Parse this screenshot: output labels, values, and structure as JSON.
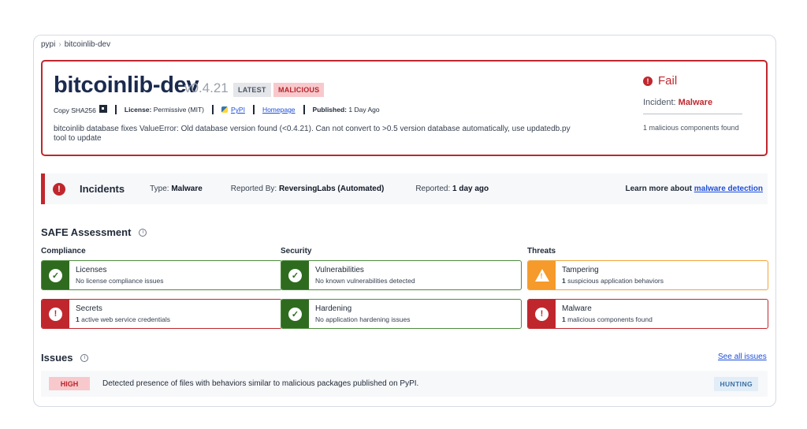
{
  "breadcrumb": {
    "root": "pypi",
    "separator": "›",
    "current": "bitcoinlib-dev"
  },
  "package": {
    "name": "bitcoinlib-dev",
    "version": "v0.4.21",
    "tags": {
      "latest": "LATEST",
      "malicious": "MALICIOUS"
    },
    "meta": {
      "copy_sha": "Copy SHA256",
      "license_label": "License:",
      "license_value": "Permissive (MIT)",
      "pypi_link": "PyPI",
      "homepage_link": "Homepage",
      "published_label": "Published:",
      "published_value": "1 Day Ago"
    },
    "description": "bitcoinlib database fixes ValueError: Old database version found (<0.4.21). Can not convert to >0.5 version database automatically, use updatedb.py tool to update"
  },
  "status": {
    "fail_label": "Fail",
    "incident_label": "Incident:",
    "incident_value": "Malware",
    "summary": "1 malicious components found"
  },
  "incidents": {
    "title": "Incidents",
    "type_label": "Type:",
    "type_value": "Malware",
    "reported_by_label": "Reported By:",
    "reported_by_value": "ReversingLabs (Automated)",
    "reported_label": "Reported:",
    "reported_value": "1 day ago",
    "learn_text": "Learn more about",
    "learn_link": "malware detection"
  },
  "safe": {
    "title": "SAFE Assessment",
    "columns": [
      {
        "heading": "Compliance",
        "cards": [
          {
            "title": "Licenses",
            "count": "",
            "subtitle": "No license compliance issues",
            "status": "ok"
          },
          {
            "title": "Secrets",
            "count": "1",
            "subtitle": " active web service credentials",
            "status": "bad"
          }
        ]
      },
      {
        "heading": "Security",
        "cards": [
          {
            "title": "Vulnerabilities",
            "count": "",
            "subtitle": "No known vulnerabilities detected",
            "status": "ok"
          },
          {
            "title": "Hardening",
            "count": "",
            "subtitle": "No application hardening issues",
            "status": "ok"
          }
        ]
      },
      {
        "heading": "Threats",
        "cards": [
          {
            "title": "Tampering",
            "count": "1",
            "subtitle": " suspicious application behaviors",
            "status": "warn"
          },
          {
            "title": "Malware",
            "count": "1",
            "subtitle": " malicious components found",
            "status": "bad"
          }
        ]
      }
    ]
  },
  "issues": {
    "title": "Issues",
    "see_all": "See all issues",
    "rows": [
      {
        "severity": "HIGH",
        "text": "Detected presence of files with behaviors similar to malicious packages published on PyPI.",
        "tag": "HUNTING"
      }
    ]
  },
  "colors": {
    "danger": "#c0272d",
    "success": "#2e6b1e",
    "warning": "#f59a2b",
    "link": "#1d4ed8",
    "title": "#1b2a4e"
  },
  "icons": {
    "copy": "copy-icon",
    "pypi": "python-icon",
    "fail": "error-circle-icon",
    "info": "info-icon",
    "ok": "check-circle-icon",
    "bad": "alert-circle-icon",
    "warn": "warning-triangle-icon"
  }
}
